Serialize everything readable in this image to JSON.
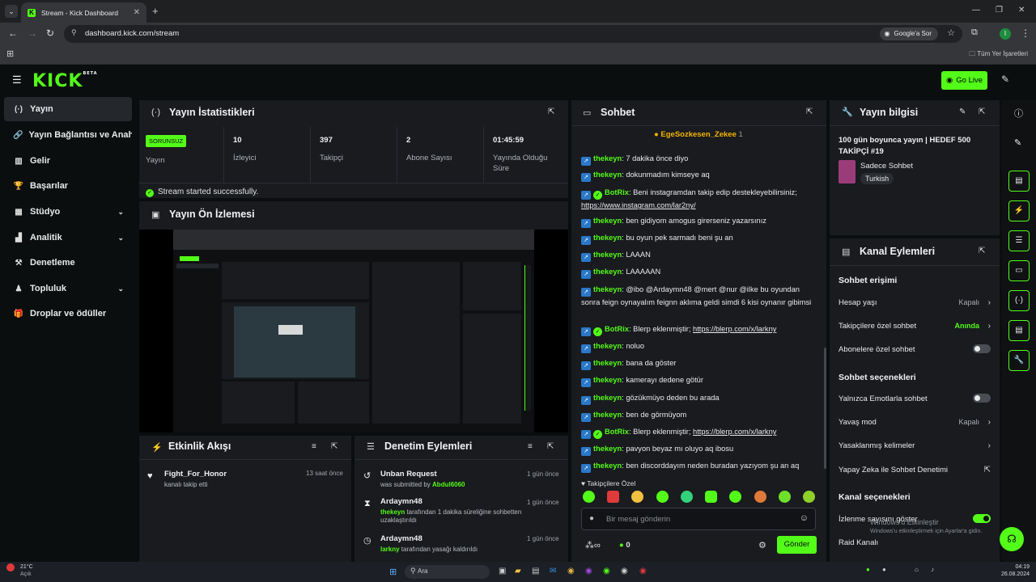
{
  "browser": {
    "tab_title": "Stream - Kick Dashboard",
    "url": "dashboard.kick.com/stream",
    "google_sor": "Google'a Sor",
    "bookmarks_all": "Tüm Yer İşaretleri",
    "profile_initial": "I"
  },
  "header": {
    "logo": "KICK",
    "logo_beta": "BETA",
    "go_live": "Go Live"
  },
  "sidebar": {
    "items": [
      {
        "label": "Yayın",
        "icon": "broadcast-icon"
      },
      {
        "label": "Yayın Bağlantısı ve Anahtar",
        "icon": "link-icon"
      },
      {
        "label": "Gelir",
        "icon": "revenue-icon"
      },
      {
        "label": "Başarılar",
        "icon": "trophy-icon"
      },
      {
        "label": "Stüdyo",
        "icon": "studio-icon"
      },
      {
        "label": "Analitik",
        "icon": "analytics-icon"
      },
      {
        "label": "Denetleme",
        "icon": "hammer-icon"
      },
      {
        "label": "Topluluk",
        "icon": "community-icon"
      },
      {
        "label": "Droplar ve ödüller",
        "icon": "drops-icon"
      }
    ]
  },
  "stats": {
    "title": "Yayın İstatistikleri",
    "badge": "SORUNSUZ",
    "badge_label": "Yayın",
    "items": [
      {
        "value": "10",
        "label": "İzleyici"
      },
      {
        "value": "397",
        "label": "Takipçi"
      },
      {
        "value": "2",
        "label": "Abone Sayısı"
      },
      {
        "value": "01:45:59",
        "label": "Yayında Olduğu Süre"
      }
    ],
    "status": "Stream started successfully."
  },
  "preview": {
    "title": "Yayın Ön İzlemesi"
  },
  "activity": {
    "title": "Etkinlik Akışı",
    "items": [
      {
        "name": "Fight_For_Honor",
        "sub": "kanalı takip etti",
        "time": "13 saat önce"
      }
    ]
  },
  "moderation": {
    "title": "Denetim Eylemleri",
    "items": [
      {
        "name": "Unban Request",
        "pre": "was submitted by ",
        "hl": "Abdul6060",
        "post": "",
        "time": "1 gün önce"
      },
      {
        "name": "Ardaymn48",
        "pre": "",
        "hl": "thekeyn",
        "post": " tarafından 1 dakika süreliğine sohbetten uzaklaştırıldı",
        "time": "1 gün önce"
      },
      {
        "name": "Ardaymn48",
        "pre": "",
        "hl": "larkny",
        "post": " tarafından yasağı kaldırıldı",
        "time": "1 gün önce"
      }
    ]
  },
  "chat": {
    "title": "Sohbet",
    "pinned_user": "EgeSozkesen_Zekee",
    "pinned_count": "1",
    "messages": [
      {
        "user": "thekeyn",
        "text": "7 dakika önce diyo"
      },
      {
        "user": "thekeyn",
        "text": "dokunmadım kimseye aq"
      },
      {
        "user": "BotRix",
        "text": "Beni instagramdan takip edip destekleyebilirsiniz;",
        "link": "https://www.instagram.com/lar2ny/"
      },
      {
        "user": "thekeyn",
        "text": "ben gidiyom amogus girerseniz yazarsınız"
      },
      {
        "user": "thekeyn",
        "text": "bu oyun pek sarmadı beni şu an"
      },
      {
        "user": "thekeyn",
        "text": "LAAAN"
      },
      {
        "user": "thekeyn",
        "text": "LAAAAAN"
      },
      {
        "user": "thekeyn",
        "text": "@ibo @Ardaymn48 @mert @nur @ilke bu oyundan sonra feign oynayalım feignn aklıma geldi simdi 6 kisi oynanır gibimsi"
      },
      {
        "user": "BotRix",
        "text": "Blerp eklenmiştir;",
        "link": "https://blerp.com/x/larkny"
      },
      {
        "user": "thekeyn",
        "text": "noluo"
      },
      {
        "user": "thekeyn",
        "text": "bana da göster"
      },
      {
        "user": "thekeyn",
        "text": "kamerayı dedene götür"
      },
      {
        "user": "thekeyn",
        "text": "gözükmüyo deden bu arada"
      },
      {
        "user": "thekeyn",
        "text": "ben de görmüyom"
      },
      {
        "user": "BotRix",
        "text": "Blerp eklenmiştir;",
        "link": "https://blerp.com/x/larkny"
      },
      {
        "user": "thekeyn",
        "text": "pavyon beyaz mı oluyo aq ibosu"
      },
      {
        "user": "thekeyn",
        "text": "ben discorddayım neden buradan yazıyom şu an aq"
      }
    ],
    "followers_only": "Takipçilere Özel",
    "input_placeholder": "Bir mesaj gönderin",
    "infinity": "∞",
    "points": "0",
    "send": "Gönder"
  },
  "stream_info": {
    "title": "Yayın bilgisi",
    "stream_title": "100 gün boyunca yayın | HEDEF 500 TAKİPÇİ #19",
    "category": "Sadece Sohbet",
    "tag": "Turkish"
  },
  "channel_actions": {
    "title": "Kanal Eylemleri",
    "chat_access": "Sohbet erişimi",
    "account_age": "Hesap yaşı",
    "account_age_value": "Kapalı",
    "followers_chat": "Takipçilere özel sohbet",
    "followers_chat_value": "Anında",
    "subs_chat": "Abonelere özel sohbet",
    "chat_options": "Sohbet seçenekleri",
    "emotes_only": "Yalnızca Emotlarla sohbet",
    "slow_mode": "Yavaş mod",
    "slow_mode_value": "Kapalı",
    "banned_words": "Yasaklanmış kelimeler",
    "ai_mod": "Yapay Zeka ile Sohbet Denetimi",
    "channel_options": "Kanal seçenekleri",
    "show_views": "İzlenme sayısını göster",
    "raid": "Raid Kanalı"
  },
  "watermark": {
    "line1": "Windows'u Etkinleştir",
    "line2": "Windows'u etkinleştirmek için Ayarlar'a gidin."
  },
  "taskbar": {
    "weather_temp": "21°C",
    "weather_desc": "Açık",
    "search": "Ara",
    "time": "04:19",
    "date": "26.08.2024"
  }
}
